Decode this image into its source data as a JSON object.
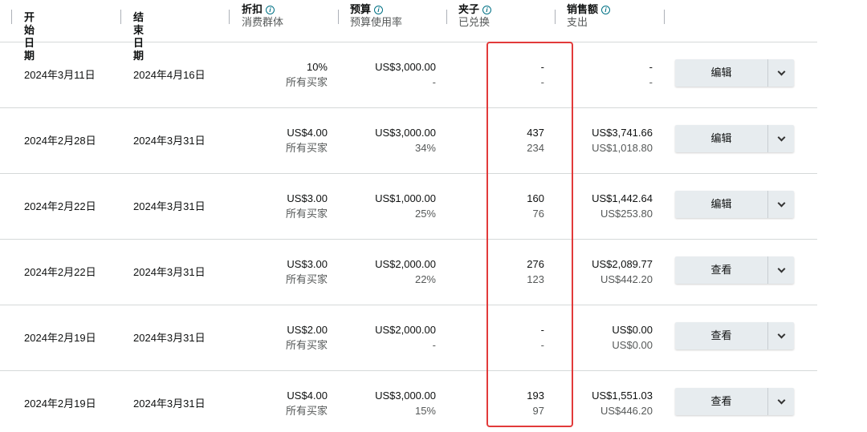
{
  "header": {
    "start_date": "开始日期",
    "end_date": "结束日期",
    "discount": "折扣",
    "discount_sub": "消费群体",
    "budget": "预算",
    "budget_sub": "预算使用率",
    "clip": "夹子",
    "clip_sub": "已兑换",
    "sales": "销售额",
    "sales_sub": "支出",
    "info_glyph": "i"
  },
  "highlight_color": "#e23a3a",
  "rows": [
    {
      "start": "2024年3月11日",
      "end": "2024年4月16日",
      "discount": "10%",
      "audience": "所有买家",
      "budget": "US$3,000.00",
      "usage": "-",
      "clips": "-",
      "redeemed": "-",
      "sales": "-",
      "spend": "-",
      "action": "编辑"
    },
    {
      "start": "2024年2月28日",
      "end": "2024年3月31日",
      "discount": "US$4.00",
      "audience": "所有买家",
      "budget": "US$3,000.00",
      "usage": "34%",
      "clips": "437",
      "redeemed": "234",
      "sales": "US$3,741.66",
      "spend": "US$1,018.80",
      "action": "编辑"
    },
    {
      "start": "2024年2月22日",
      "end": "2024年3月31日",
      "discount": "US$3.00",
      "audience": "所有买家",
      "budget": "US$1,000.00",
      "usage": "25%",
      "clips": "160",
      "redeemed": "76",
      "sales": "US$1,442.64",
      "spend": "US$253.80",
      "action": "编辑"
    },
    {
      "start": "2024年2月22日",
      "end": "2024年3月31日",
      "discount": "US$3.00",
      "audience": "所有买家",
      "budget": "US$2,000.00",
      "usage": "22%",
      "clips": "276",
      "redeemed": "123",
      "sales": "US$2,089.77",
      "spend": "US$442.20",
      "action": "查看"
    },
    {
      "start": "2024年2月19日",
      "end": "2024年3月31日",
      "discount": "US$2.00",
      "audience": "所有买家",
      "budget": "US$2,000.00",
      "usage": "-",
      "clips": "-",
      "redeemed": "-",
      "sales": "US$0.00",
      "spend": "US$0.00",
      "action": "查看"
    },
    {
      "start": "2024年2月19日",
      "end": "2024年3月31日",
      "discount": "US$4.00",
      "audience": "所有买家",
      "budget": "US$3,000.00",
      "usage": "15%",
      "clips": "193",
      "redeemed": "97",
      "sales": "US$1,551.03",
      "spend": "US$446.20",
      "action": "查看"
    }
  ]
}
